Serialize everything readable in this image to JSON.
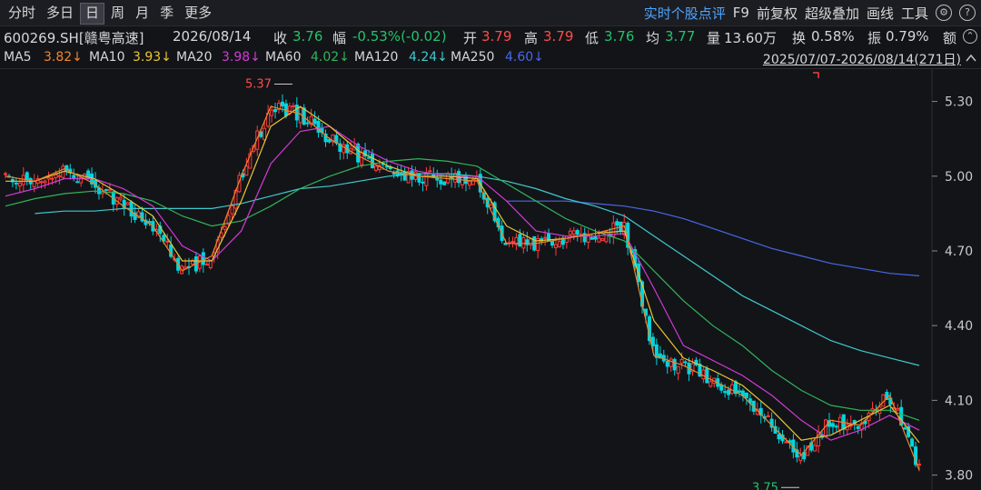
{
  "toolbar": {
    "tabs": [
      "分时",
      "多日",
      "日",
      "周",
      "月",
      "季",
      "更多"
    ],
    "active_tab": "日",
    "right_links": [
      "实时个股点评",
      "F9",
      "前复权",
      "超级叠加",
      "画线",
      "工具"
    ]
  },
  "quote": {
    "code": "600269.SH[赣粤高速]",
    "date": "2026/08/14",
    "close_label": "收",
    "close": "3.76",
    "range_label": "幅",
    "change": "-0.53%(-0.02)",
    "open_label": "开",
    "open": "3.79",
    "high_label": "高",
    "high": "3.79",
    "low_label": "低",
    "low": "3.76",
    "avg_label": "均",
    "avg": "3.77",
    "volume_label": "量",
    "volume": "13.60万",
    "turnover_label": "换",
    "turnover": "0.58%",
    "amplitude_label": "振",
    "amplitude": "0.79%",
    "amount_label": "额"
  },
  "ma_legend": {
    "ma5": {
      "label": "MA5",
      "value": "3.82↓",
      "color": "#f0862a"
    },
    "ma10": {
      "label": "MA10",
      "value": "3.93↓",
      "color": "#e8c535"
    },
    "ma20": {
      "label": "MA20",
      "value": "3.98↓",
      "color": "#d23ad6"
    },
    "ma60": {
      "label": "MA60",
      "value": "4.02↓",
      "color": "#2fb55a"
    },
    "ma120": {
      "label": "MA120",
      "value": "4.24↓",
      "color": "#3fc9cc"
    },
    "ma250": {
      "label": "MA250",
      "value": "4.60↓",
      "color": "#4868e6"
    },
    "date_range": "2025/07/07-2026/08/14(271日)"
  },
  "chart_data": {
    "type": "candlestick",
    "y_ticks": [
      "5.30",
      "5.00",
      "4.70",
      "4.40",
      "4.10",
      "3.80"
    ],
    "ylim": [
      3.74,
      5.43
    ],
    "high_annotation": "5.37",
    "low_annotation": "3.75",
    "colors": {
      "up": "#ff3b3b",
      "down": "#00d5dc"
    },
    "ma_curves": {
      "ma5": [
        5.0,
        4.98,
        5.03,
        4.97,
        4.88,
        4.8,
        4.62,
        4.68,
        5.0,
        5.28,
        5.25,
        5.15,
        5.08,
        5.02,
        5.0,
        4.99,
        4.98,
        4.73,
        4.73,
        4.75,
        4.77,
        4.8,
        4.28,
        4.24,
        4.18,
        4.12,
        4.0,
        3.88,
        4.02,
        4.0,
        4.12,
        3.82
      ],
      "ma10": [
        4.98,
        4.98,
        5.02,
        4.99,
        4.92,
        4.84,
        4.66,
        4.66,
        4.9,
        5.2,
        5.28,
        5.2,
        5.1,
        5.04,
        5.0,
        5.0,
        4.99,
        4.8,
        4.74,
        4.75,
        4.77,
        4.78,
        4.42,
        4.27,
        4.22,
        4.16,
        4.06,
        3.94,
        3.96,
        4.02,
        4.08,
        3.93
      ],
      "ma20": [
        4.92,
        4.95,
        4.99,
        4.99,
        4.95,
        4.88,
        4.72,
        4.66,
        4.78,
        5.05,
        5.18,
        5.2,
        5.12,
        5.06,
        5.02,
        5.0,
        5.0,
        4.9,
        4.78,
        4.76,
        4.76,
        4.77,
        4.55,
        4.32,
        4.26,
        4.2,
        4.12,
        4.02,
        3.94,
        3.98,
        4.04,
        3.98
      ],
      "ma60": [
        4.88,
        4.91,
        4.93,
        4.94,
        4.93,
        4.9,
        4.84,
        4.8,
        4.82,
        4.88,
        4.95,
        5.0,
        5.04,
        5.06,
        5.07,
        5.06,
        5.04,
        4.97,
        4.9,
        4.83,
        4.78,
        4.74,
        4.62,
        4.5,
        4.4,
        4.32,
        4.22,
        4.14,
        4.08,
        4.06,
        4.06,
        4.02
      ],
      "ma120": [
        null,
        4.85,
        4.86,
        4.86,
        4.87,
        4.87,
        4.87,
        4.87,
        4.89,
        4.92,
        4.95,
        4.96,
        4.98,
        5.0,
        5.01,
        5.01,
        5.0,
        4.98,
        4.95,
        4.91,
        4.88,
        4.84,
        4.76,
        4.68,
        4.6,
        4.52,
        4.46,
        4.4,
        4.34,
        4.3,
        4.27,
        4.24
      ],
      "ma250": [
        null,
        null,
        null,
        null,
        null,
        null,
        null,
        null,
        null,
        null,
        null,
        null,
        null,
        null,
        null,
        null,
        null,
        4.9,
        4.9,
        4.9,
        4.89,
        4.88,
        4.86,
        4.83,
        4.79,
        4.75,
        4.71,
        4.68,
        4.65,
        4.63,
        4.61,
        4.6
      ]
    }
  }
}
